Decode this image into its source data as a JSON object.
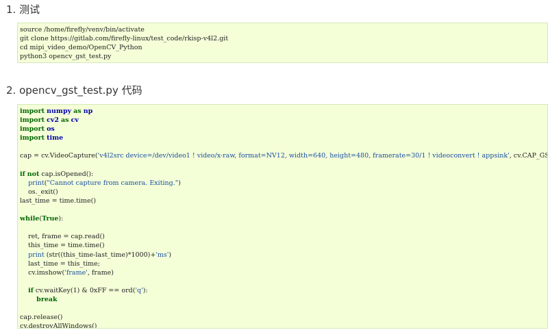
{
  "section1": {
    "heading": "1. 测试",
    "code_lines": [
      "source /home/firefly/venv/bin/activate",
      "git clone https://gitlab.com/firefly-linux/test_code/rkisp-v4l2.git",
      "cd mipi_video_demo/OpenCV_Python",
      "python3 opencv_gst_test.py"
    ]
  },
  "section2": {
    "heading": "2. opencv_gst_test.py 代码",
    "code_lines": [
      [
        {
          "t": "import",
          "c": "kw"
        },
        {
          "t": " "
        },
        {
          "t": "numpy",
          "c": "mod"
        },
        {
          "t": " "
        },
        {
          "t": "as",
          "c": "kw"
        },
        {
          "t": " "
        },
        {
          "t": "np",
          "c": "mod"
        }
      ],
      [
        {
          "t": "import",
          "c": "kw"
        },
        {
          "t": " "
        },
        {
          "t": "cv2",
          "c": "mod"
        },
        {
          "t": " "
        },
        {
          "t": "as",
          "c": "kw"
        },
        {
          "t": " "
        },
        {
          "t": "cv",
          "c": "mod"
        }
      ],
      [
        {
          "t": "import",
          "c": "kw"
        },
        {
          "t": " "
        },
        {
          "t": "os",
          "c": "mod"
        }
      ],
      [
        {
          "t": "import",
          "c": "kw"
        },
        {
          "t": " "
        },
        {
          "t": "time",
          "c": "mod"
        }
      ],
      [],
      [
        {
          "t": "cap = cv.VideoCapture("
        },
        {
          "t": "'v4l2src device=/dev/video1 ! video/x-raw, format=NV12, width=640, height=480, framerate=30/1 ! videoconvert ! appsink'",
          "c": "str"
        },
        {
          "t": ", cv.CAP_GSTREAMER)"
        }
      ],
      [],
      [
        {
          "t": "if",
          "c": "kw"
        },
        {
          "t": " "
        },
        {
          "t": "not",
          "c": "kw"
        },
        {
          "t": " cap.isOpened():"
        }
      ],
      [
        {
          "t": "    "
        },
        {
          "t": "print",
          "c": "str"
        },
        {
          "t": "("
        },
        {
          "t": "\"Cannot capture from camera. Exiting.\"",
          "c": "str"
        },
        {
          "t": ")"
        }
      ],
      [
        {
          "t": "    os._exit()"
        }
      ],
      [
        {
          "t": "last_time = time.time()"
        }
      ],
      [],
      [
        {
          "t": "while",
          "c": "kw"
        },
        {
          "t": "("
        },
        {
          "t": "True",
          "c": "kw"
        },
        {
          "t": "):"
        }
      ],
      [],
      [
        {
          "t": "    ret, frame = cap.read()"
        }
      ],
      [
        {
          "t": "    this_time = time.time()"
        }
      ],
      [
        {
          "t": "    "
        },
        {
          "t": "print",
          "c": "str"
        },
        {
          "t": " (str((this_time-last_time)*1000)+"
        },
        {
          "t": "'ms'",
          "c": "str"
        },
        {
          "t": ")"
        }
      ],
      [
        {
          "t": "    last_time = this_time;"
        }
      ],
      [
        {
          "t": "    cv.imshow("
        },
        {
          "t": "'frame'",
          "c": "str"
        },
        {
          "t": ", frame)"
        }
      ],
      [],
      [
        {
          "t": "    "
        },
        {
          "t": "if",
          "c": "kw"
        },
        {
          "t": " cv.waitKey(1) & 0xFF == ord("
        },
        {
          "t": "'q'",
          "c": "str"
        },
        {
          "t": "):"
        }
      ],
      [
        {
          "t": "        "
        },
        {
          "t": "break",
          "c": "kw"
        }
      ],
      [],
      [
        {
          "t": "cap.release()"
        }
      ],
      [
        {
          "t": "cv.destroyAllWindows()"
        }
      ]
    ]
  }
}
